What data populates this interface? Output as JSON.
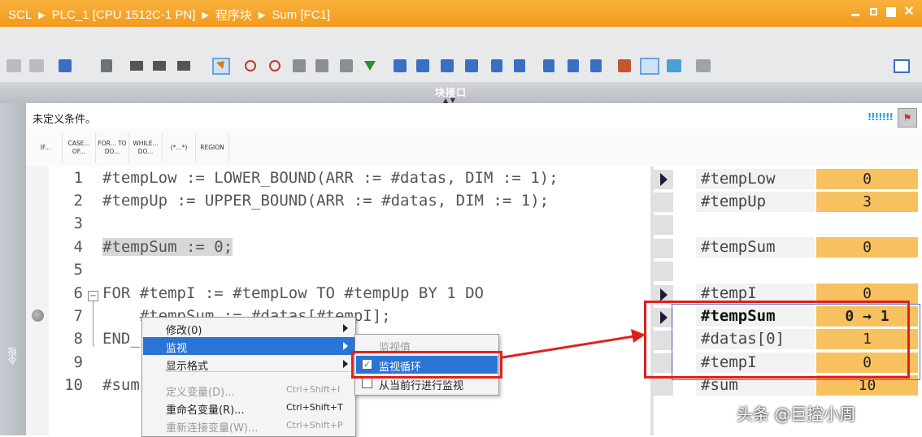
{
  "breadcrumb": [
    "SCL",
    "PLC_1 [CPU 1512C-1 PN]",
    "程序块",
    "Sum [FC1]"
  ],
  "window_buttons": {
    "close": "✕"
  },
  "section_header": "块接口",
  "condition_label": "未定义条件。",
  "condition_indicator": "!!!!!!!",
  "snippets": [
    "IF...",
    "CASE... OF...",
    "FOR... TO DO...",
    "WHILE... DO...",
    "(*...*)",
    "REGION"
  ],
  "left_panel_label": "指令",
  "code_lines": [
    {
      "num": "1",
      "text": "#tempLow := LOWER_BOUND(ARR := #datas, DIM := 1);"
    },
    {
      "num": "2",
      "text": "#tempUp := UPPER_BOUND(ARR := #datas, DIM := 1);"
    },
    {
      "num": "3",
      "text": ""
    },
    {
      "num": "4",
      "text": "#tempSum := 0;"
    },
    {
      "num": "5",
      "text": ""
    },
    {
      "num": "6",
      "text": "FOR #tempI := #tempLow TO #tempUp BY 1 DO"
    },
    {
      "num": "7",
      "text": "    #tempSum := #datas[#tempI];"
    },
    {
      "num": "8",
      "text": "END_"
    },
    {
      "num": "9",
      "text": ""
    },
    {
      "num": "10",
      "text": "#sum"
    }
  ],
  "watch": [
    {
      "name": "#tempLow",
      "value": "0"
    },
    {
      "name": "#tempUp",
      "value": "3"
    },
    {
      "name": "#tempSum",
      "value": "0"
    },
    {
      "name": "#tempI",
      "value": "0"
    },
    {
      "name": "#tempSum",
      "value": "0 → 1"
    },
    {
      "name": "#datas[0]",
      "value": "1"
    },
    {
      "name": "#tempI",
      "value": "0"
    },
    {
      "name": "#sum",
      "value": "10"
    }
  ],
  "context_menu": {
    "items": [
      {
        "label": "修改(0)",
        "shortcut": ""
      },
      {
        "label": "监视",
        "shortcut": ""
      },
      {
        "label": "显示格式",
        "shortcut": ""
      },
      {
        "label": "定义变量(D)...",
        "shortcut": "Ctrl+Shift+I"
      },
      {
        "label": "重命名变量(R)...",
        "shortcut": "Ctrl+Shift+T"
      },
      {
        "label": "重新连接变量(W)...",
        "shortcut": "Ctrl+Shift+P"
      }
    ]
  },
  "submenu": {
    "items": [
      {
        "label": "监视值"
      },
      {
        "label": "监视循环"
      },
      {
        "label": "从当前行进行监视"
      }
    ]
  },
  "watermark": "头条 @巨控小周",
  "colors": {
    "title_bar": "#f39a1d",
    "watch_value": "#f6c15e",
    "highlight_box": "#e02020",
    "menu_selection": "#2a74d6"
  }
}
